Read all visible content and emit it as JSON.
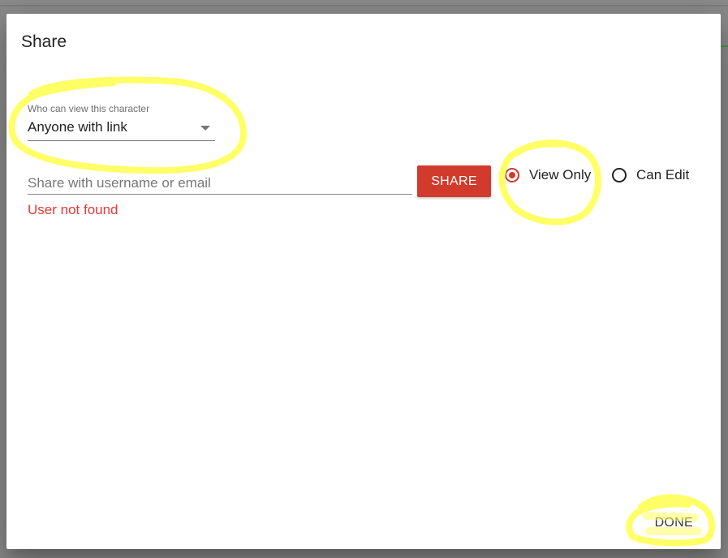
{
  "dialog": {
    "title": "Share",
    "visibility_select": {
      "label": "Who can view this character",
      "value": "Anyone with link"
    },
    "share_input": {
      "placeholder": "Share with username or email",
      "value": ""
    },
    "share_button_label": "SHARE",
    "error_message": "User not found",
    "permission_options": [
      {
        "label": "View Only",
        "selected": true
      },
      {
        "label": "Can Edit",
        "selected": false
      }
    ],
    "done_button_label": "DONE"
  },
  "colors": {
    "accent": "#d23a2c",
    "error": "#e53935",
    "highlight": "#ffff66"
  }
}
